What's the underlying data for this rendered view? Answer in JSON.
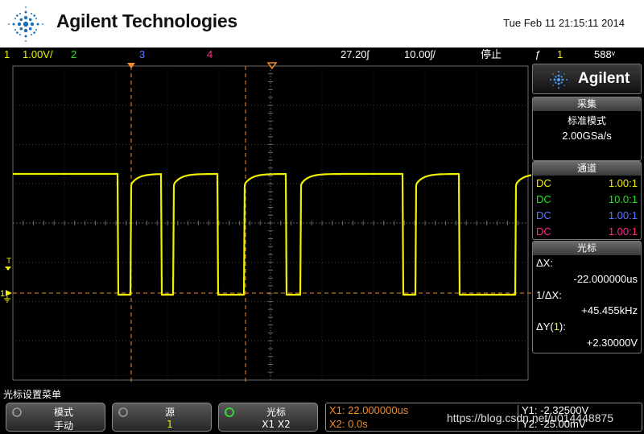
{
  "header": {
    "brand": "Agilent Technologies",
    "datetime": "Tue Feb 11 21:15:11 2014"
  },
  "status": {
    "ch1_num": "1",
    "ch1_scale": "1.00V/",
    "ch2_num": "2",
    "ch3_num": "3",
    "ch4_num": "4",
    "delay": "27.20ʃ",
    "timebase": "10.00ʃ/",
    "run_state": "停止",
    "trigger_icon": "ƒ",
    "trigger_source": "1",
    "trigger_level": "588ᵛ"
  },
  "side": {
    "logo_text": "Agilent",
    "acq_head": "采集",
    "acq_mode": "标准模式",
    "acq_rate": "2.00GSa/s",
    "chan_head": "通道",
    "channels": [
      {
        "coupling": "DC",
        "probe": "1.00:1",
        "color": "#f0f000"
      },
      {
        "coupling": "DC",
        "probe": "10.0:1",
        "color": "#22e022"
      },
      {
        "coupling": "DC",
        "probe": "1.00:1",
        "color": "#5a78ff"
      },
      {
        "coupling": "DC",
        "probe": "1.00:1",
        "color": "#ff2a8a"
      }
    ],
    "cursor_head": "光标",
    "dx_label": "ΔX:",
    "dx_value": "-22.000000us",
    "inv_dx_label": "1/ΔX:",
    "inv_dx_value": "+45.455kHz",
    "dy_label_pre": "ΔY(",
    "dy_label_ch": "1",
    "dy_label_post": "):",
    "dy_value": "+2.30000V"
  },
  "menu": {
    "title": "光标设置菜单",
    "keys": [
      {
        "top": "模式",
        "bottom": "手动"
      },
      {
        "top": "源",
        "bottom": "1"
      },
      {
        "top": "光标",
        "bottom": "X1 X2"
      }
    ]
  },
  "readout": {
    "x1": "X1: 22.000000us",
    "x2": "X2: 0.0s",
    "y1": "Y1: -2.32500V",
    "y2": "Y2: -25.00mV"
  },
  "watermark": "https://blog.csdn.net/u014448875",
  "colors": {
    "ch1": "#f0f000",
    "ch2": "#22e022",
    "ch3": "#5a78ff",
    "ch4": "#ff2a8a",
    "cursor": "#f08c2a"
  },
  "screen_markers": {
    "trigger_level_marker": "T",
    "ground_marker": "1"
  }
}
